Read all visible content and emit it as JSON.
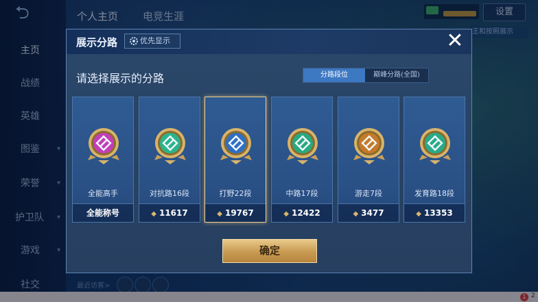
{
  "top_tabs": [
    "个人主页",
    "电竞生涯"
  ],
  "settings_label": "设置",
  "top_right_strip": "王和按照展示",
  "nav": [
    {
      "label": "主页",
      "active": true
    },
    {
      "label": "战绩"
    },
    {
      "label": "英雄"
    },
    {
      "label": "图鉴"
    },
    {
      "label": "荣誉"
    },
    {
      "label": "护卫队"
    },
    {
      "label": "游戏"
    },
    {
      "label": "社交"
    }
  ],
  "recent_visit": "最近访客>",
  "bottom_notification": {
    "count": "1",
    "text": "2"
  },
  "modal": {
    "title": "展示分路",
    "priority_label": "优先显示",
    "close": "✕",
    "subtitle": "请选择展示的分路",
    "segmented": {
      "options": [
        "分路段位",
        "巅峰分路(全国)"
      ],
      "selected": 0
    },
    "cards": [
      {
        "name": "全能高手",
        "value": "全能称号",
        "show_icon": false,
        "badge_color": "#c23eb8",
        "selected": false
      },
      {
        "name": "对抗路16段",
        "value": "11617",
        "show_icon": true,
        "badge_color": "#2bb48c",
        "selected": false
      },
      {
        "name": "打野22段",
        "value": "19767",
        "show_icon": true,
        "badge_color": "#2f6fc2",
        "selected": true
      },
      {
        "name": "中路17段",
        "value": "12422",
        "show_icon": true,
        "badge_color": "#28a980",
        "selected": false
      },
      {
        "name": "游走7段",
        "value": "3477",
        "show_icon": true,
        "badge_color": "#c57a28",
        "selected": false
      },
      {
        "name": "发育路18段",
        "value": "13353",
        "show_icon": true,
        "badge_color": "#27ab87",
        "selected": false
      }
    ],
    "confirm_label": "确定"
  },
  "icons": {
    "back": "back-arrow-icon",
    "gear": "gear-icon",
    "close": "close-icon",
    "rank": "rank-wing-icon"
  }
}
